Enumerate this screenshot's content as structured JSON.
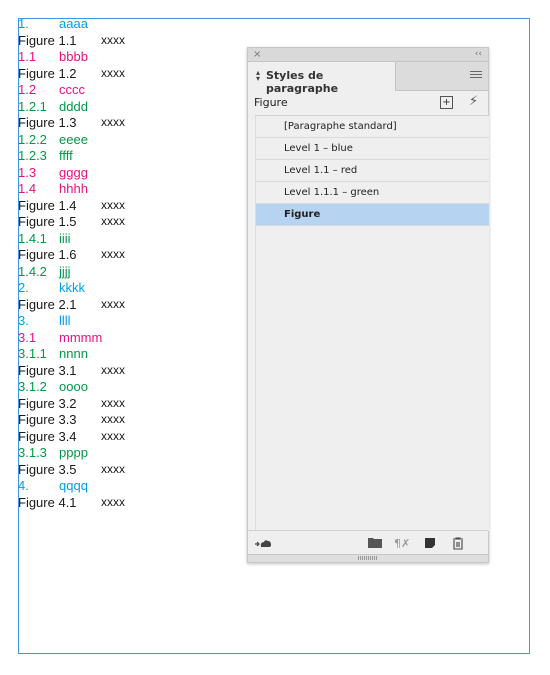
{
  "document": {
    "lines": [
      {
        "num": "1.",
        "text": "aaaa",
        "extra": "",
        "kind": "blue"
      },
      {
        "num": "Figure 1.1",
        "text": "",
        "extra": "xxxx",
        "kind": "black"
      },
      {
        "num": "1.1",
        "text": "bbbb",
        "extra": "",
        "kind": "red"
      },
      {
        "num": "Figure 1.2",
        "text": "",
        "extra": "xxxx",
        "kind": "black"
      },
      {
        "num": "1.2",
        "text": "cccc",
        "extra": "",
        "kind": "red"
      },
      {
        "num": "1.2.1",
        "text": "dddd",
        "extra": "",
        "kind": "green"
      },
      {
        "num": "Figure 1.3",
        "text": "",
        "extra": "xxxx",
        "kind": "black"
      },
      {
        "num": "1.2.2",
        "text": "eeee",
        "extra": "",
        "kind": "green"
      },
      {
        "num": "1.2.3",
        "text": "ffff",
        "extra": "",
        "kind": "green"
      },
      {
        "num": "1.3",
        "text": "gggg",
        "extra": "",
        "kind": "red"
      },
      {
        "num": "1.4",
        "text": "hhhh",
        "extra": "",
        "kind": "red"
      },
      {
        "num": "Figure 1.4",
        "text": "",
        "extra": "xxxx",
        "kind": "black"
      },
      {
        "num": "Figure 1.5",
        "text": "",
        "extra": "xxxx",
        "kind": "black"
      },
      {
        "num": "1.4.1",
        "text": "iiii",
        "extra": "",
        "kind": "green"
      },
      {
        "num": "Figure 1.6",
        "text": "",
        "extra": "xxxx",
        "kind": "black"
      },
      {
        "num": "1.4.2",
        "text": "jjjj",
        "extra": "",
        "kind": "green"
      },
      {
        "num": "2.",
        "text": "kkkk",
        "extra": "",
        "kind": "blue"
      },
      {
        "num": "Figure 2.1",
        "text": "",
        "extra": "xxxx",
        "kind": "black"
      },
      {
        "num": "3.",
        "text": "llll",
        "extra": "",
        "kind": "blue"
      },
      {
        "num": "3.1",
        "text": "mmmm",
        "extra": "",
        "kind": "red"
      },
      {
        "num": "3.1.1",
        "text": "nnnn",
        "extra": "",
        "kind": "green"
      },
      {
        "num": "Figure 3.1",
        "text": "",
        "extra": "xxxx",
        "kind": "black"
      },
      {
        "num": "3.1.2",
        "text": "oooo",
        "extra": "",
        "kind": "green"
      },
      {
        "num": "Figure 3.2",
        "text": "",
        "extra": "xxxx",
        "kind": "black"
      },
      {
        "num": "Figure 3.3",
        "text": "",
        "extra": "xxxx",
        "kind": "black"
      },
      {
        "num": "Figure 3.4",
        "text": "",
        "extra": "xxxx",
        "kind": "black"
      },
      {
        "num": "3.1.3",
        "text": "pppp",
        "extra": "",
        "kind": "green"
      },
      {
        "num": "Figure 3.5",
        "text": "",
        "extra": "xxxx",
        "kind": "black"
      },
      {
        "num": "4.",
        "text": "qqqq",
        "extra": "",
        "kind": "blue"
      },
      {
        "num": "Figure 4.1",
        "text": "",
        "extra": "xxxx",
        "kind": "black"
      }
    ]
  },
  "panel": {
    "close_glyph": "×",
    "collapse_glyph": "‹‹",
    "tab_label": "Styles de paragraphe",
    "current_style": "Figure",
    "new_style_glyph": "+",
    "lightning_glyph": "⚡",
    "styles": [
      {
        "label": "[Paragraphe standard]",
        "selected": false
      },
      {
        "label": "Level 1 – blue",
        "selected": false
      },
      {
        "label": "Level 1.1 – red",
        "selected": false
      },
      {
        "label": "Level 1.1.1 – green",
        "selected": false
      },
      {
        "label": "Figure",
        "selected": true
      }
    ],
    "footer_icons": [
      "cloud-library-icon",
      "folder-icon",
      "clear-overrides-icon",
      "new-style-icon",
      "trash-icon"
    ]
  },
  "colors": {
    "blue": "#00a0e3",
    "red": "#e5147a",
    "green": "#009a46",
    "black": "#1a1a1a",
    "selection": "#b7d3f2",
    "frame": "#3b99e3"
  }
}
